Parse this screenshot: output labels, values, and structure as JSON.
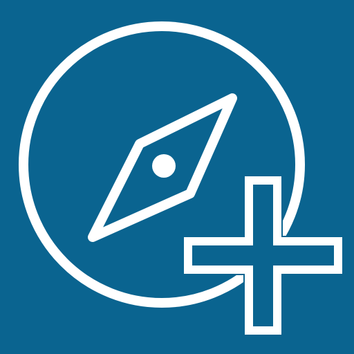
{
  "icon": {
    "name": "compass-add-icon",
    "background_color": "#0a6490",
    "stroke_color": "#ffffff",
    "components": [
      "compass-icon",
      "plus-icon"
    ]
  }
}
